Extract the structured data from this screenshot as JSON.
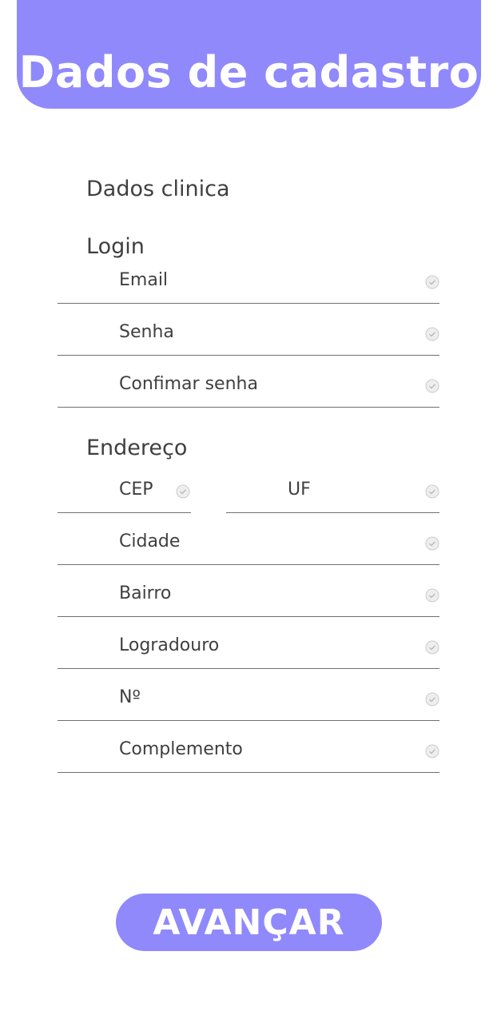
{
  "header": {
    "title": "Dados de cadastro"
  },
  "sections": {
    "clinic": "Dados clinica",
    "login": "Login",
    "address": "Endereço"
  },
  "login_fields": {
    "email": "Email",
    "password": "Senha",
    "confirm_password": "Confimar senha"
  },
  "address_fields": {
    "cep": "CEP",
    "uf": "UF",
    "city": "Cidade",
    "neighborhood": "Bairro",
    "street": "Logradouro",
    "number": "Nº",
    "complement": "Complemento"
  },
  "actions": {
    "next_label": "AVANÇAR"
  },
  "colors": {
    "accent": "#9089fc",
    "text": "#3f3f3f",
    "check": "#c9c9c9"
  },
  "icons": {
    "field_status": "check-circle-icon"
  }
}
